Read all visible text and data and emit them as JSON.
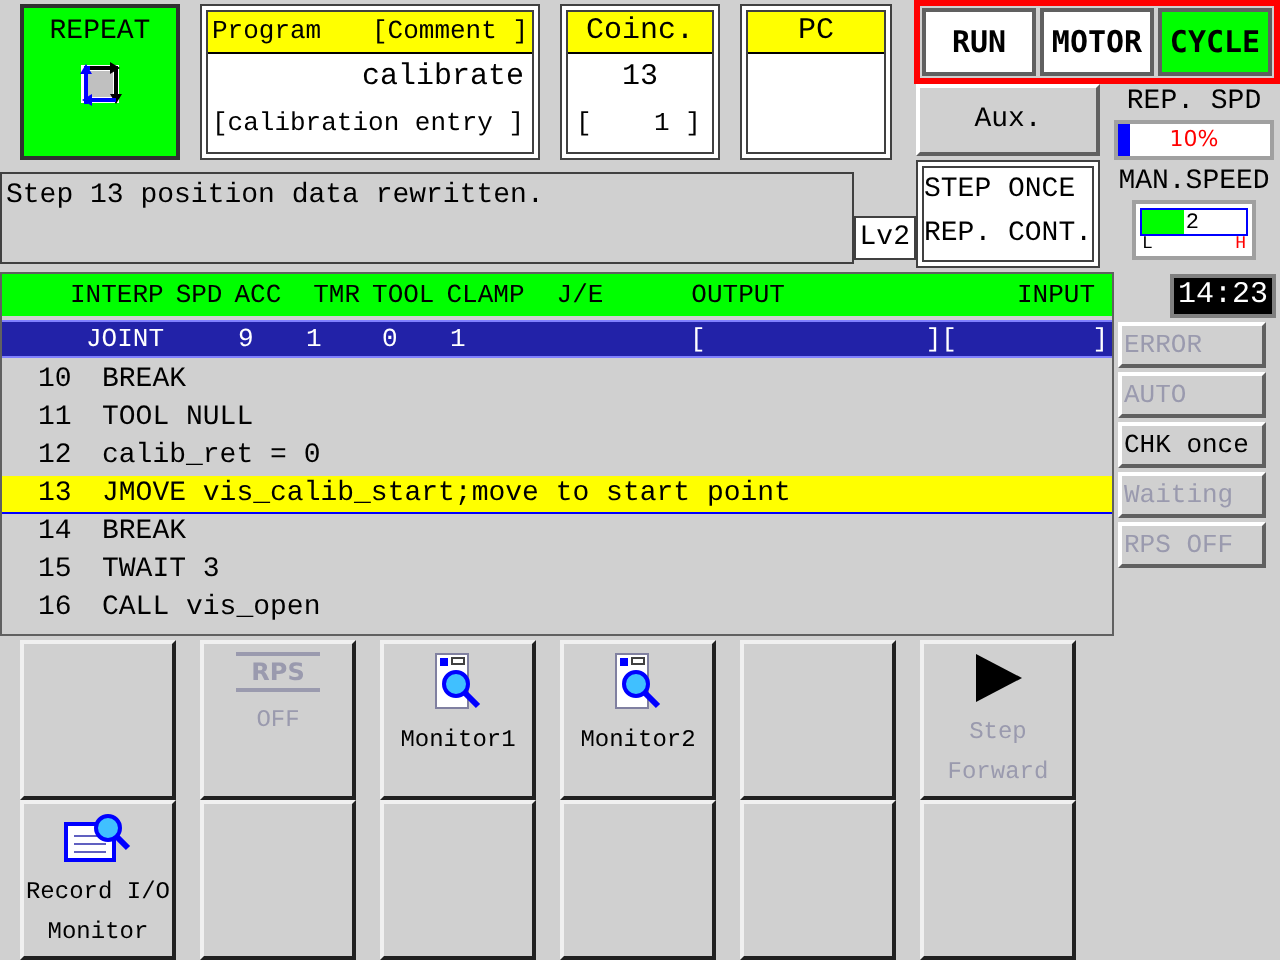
{
  "mode": {
    "label": "REPEAT"
  },
  "program": {
    "header_left": "Program",
    "header_right": "[Comment ]",
    "name": "calibrate",
    "comment": "[calibration entry ]"
  },
  "coinc": {
    "header": "Coinc.",
    "step": "13",
    "value": "[    1 ]"
  },
  "pc": {
    "header": "PC"
  },
  "status_buttons": [
    {
      "label": "RUN",
      "on": false
    },
    {
      "label": "MOTOR",
      "on": false
    },
    {
      "label": "CYCLE",
      "on": true
    }
  ],
  "aux": {
    "label": "Aux."
  },
  "rep_speed": {
    "label": "REP. SPD",
    "level": 0.08,
    "reading": "10%"
  },
  "man_speed": {
    "label": "MAN.SPEED",
    "level": 0.4,
    "reading": "2",
    "low": "L",
    "high": "H"
  },
  "step_mode": {
    "lines": [
      "STEP ONCE",
      "REP. CONT."
    ]
  },
  "message": "Step 13 position data rewritten.",
  "level_badge": "Lv2",
  "clock": "14:23",
  "indicators": [
    {
      "label": "ERROR",
      "on": false
    },
    {
      "label": "AUTO",
      "on": false
    },
    {
      "label": "CHK once",
      "on": true
    },
    {
      "label": "Waiting",
      "on": false
    },
    {
      "label": "RPS OFF",
      "on": false
    }
  ],
  "program_table": {
    "columns": [
      "INTERP",
      "SPD",
      "ACC",
      "TMR",
      "TOOL",
      "CLAMP",
      "J/E",
      "OUTPUT",
      "INPUT"
    ],
    "current": {
      "values": [
        "JOINT",
        "9",
        "1",
        "0",
        "1"
      ],
      "output_open": "[",
      "separator": "][",
      "input_close": "]"
    },
    "lines": [
      {
        "number": "10",
        "code": "BREAK",
        "selected": false
      },
      {
        "number": "11",
        "code": "TOOL NULL",
        "selected": false
      },
      {
        "number": "12",
        "code": "calib_ret = 0",
        "selected": false
      },
      {
        "number": "13",
        "code": "JMOVE vis_calib_start;move to start point",
        "selected": true
      },
      {
        "number": "14",
        "code": "BREAK",
        "selected": false
      },
      {
        "number": "15",
        "code": "TWAIT 3",
        "selected": false
      },
      {
        "number": "16",
        "code": "CALL vis_open",
        "selected": false
      }
    ]
  },
  "function_keys": [
    {
      "kind": "blank"
    },
    {
      "kind": "rps",
      "badge": "RPS",
      "lines": [
        "OFF"
      ],
      "disabled": true
    },
    {
      "kind": "monitor",
      "lines": [
        "Monitor1"
      ],
      "disabled": false
    },
    {
      "kind": "monitor",
      "lines": [
        "Monitor2"
      ],
      "disabled": false
    },
    {
      "kind": "blank"
    },
    {
      "kind": "play",
      "lines": [
        "Step",
        "Forward"
      ],
      "disabled": true
    },
    {
      "kind": "record",
      "lines": [
        "Record I/O",
        "Monitor"
      ],
      "disabled": false
    },
    {
      "kind": "blank"
    },
    {
      "kind": "blank"
    },
    {
      "kind": "blank"
    },
    {
      "kind": "blank"
    },
    {
      "kind": "blank"
    }
  ]
}
